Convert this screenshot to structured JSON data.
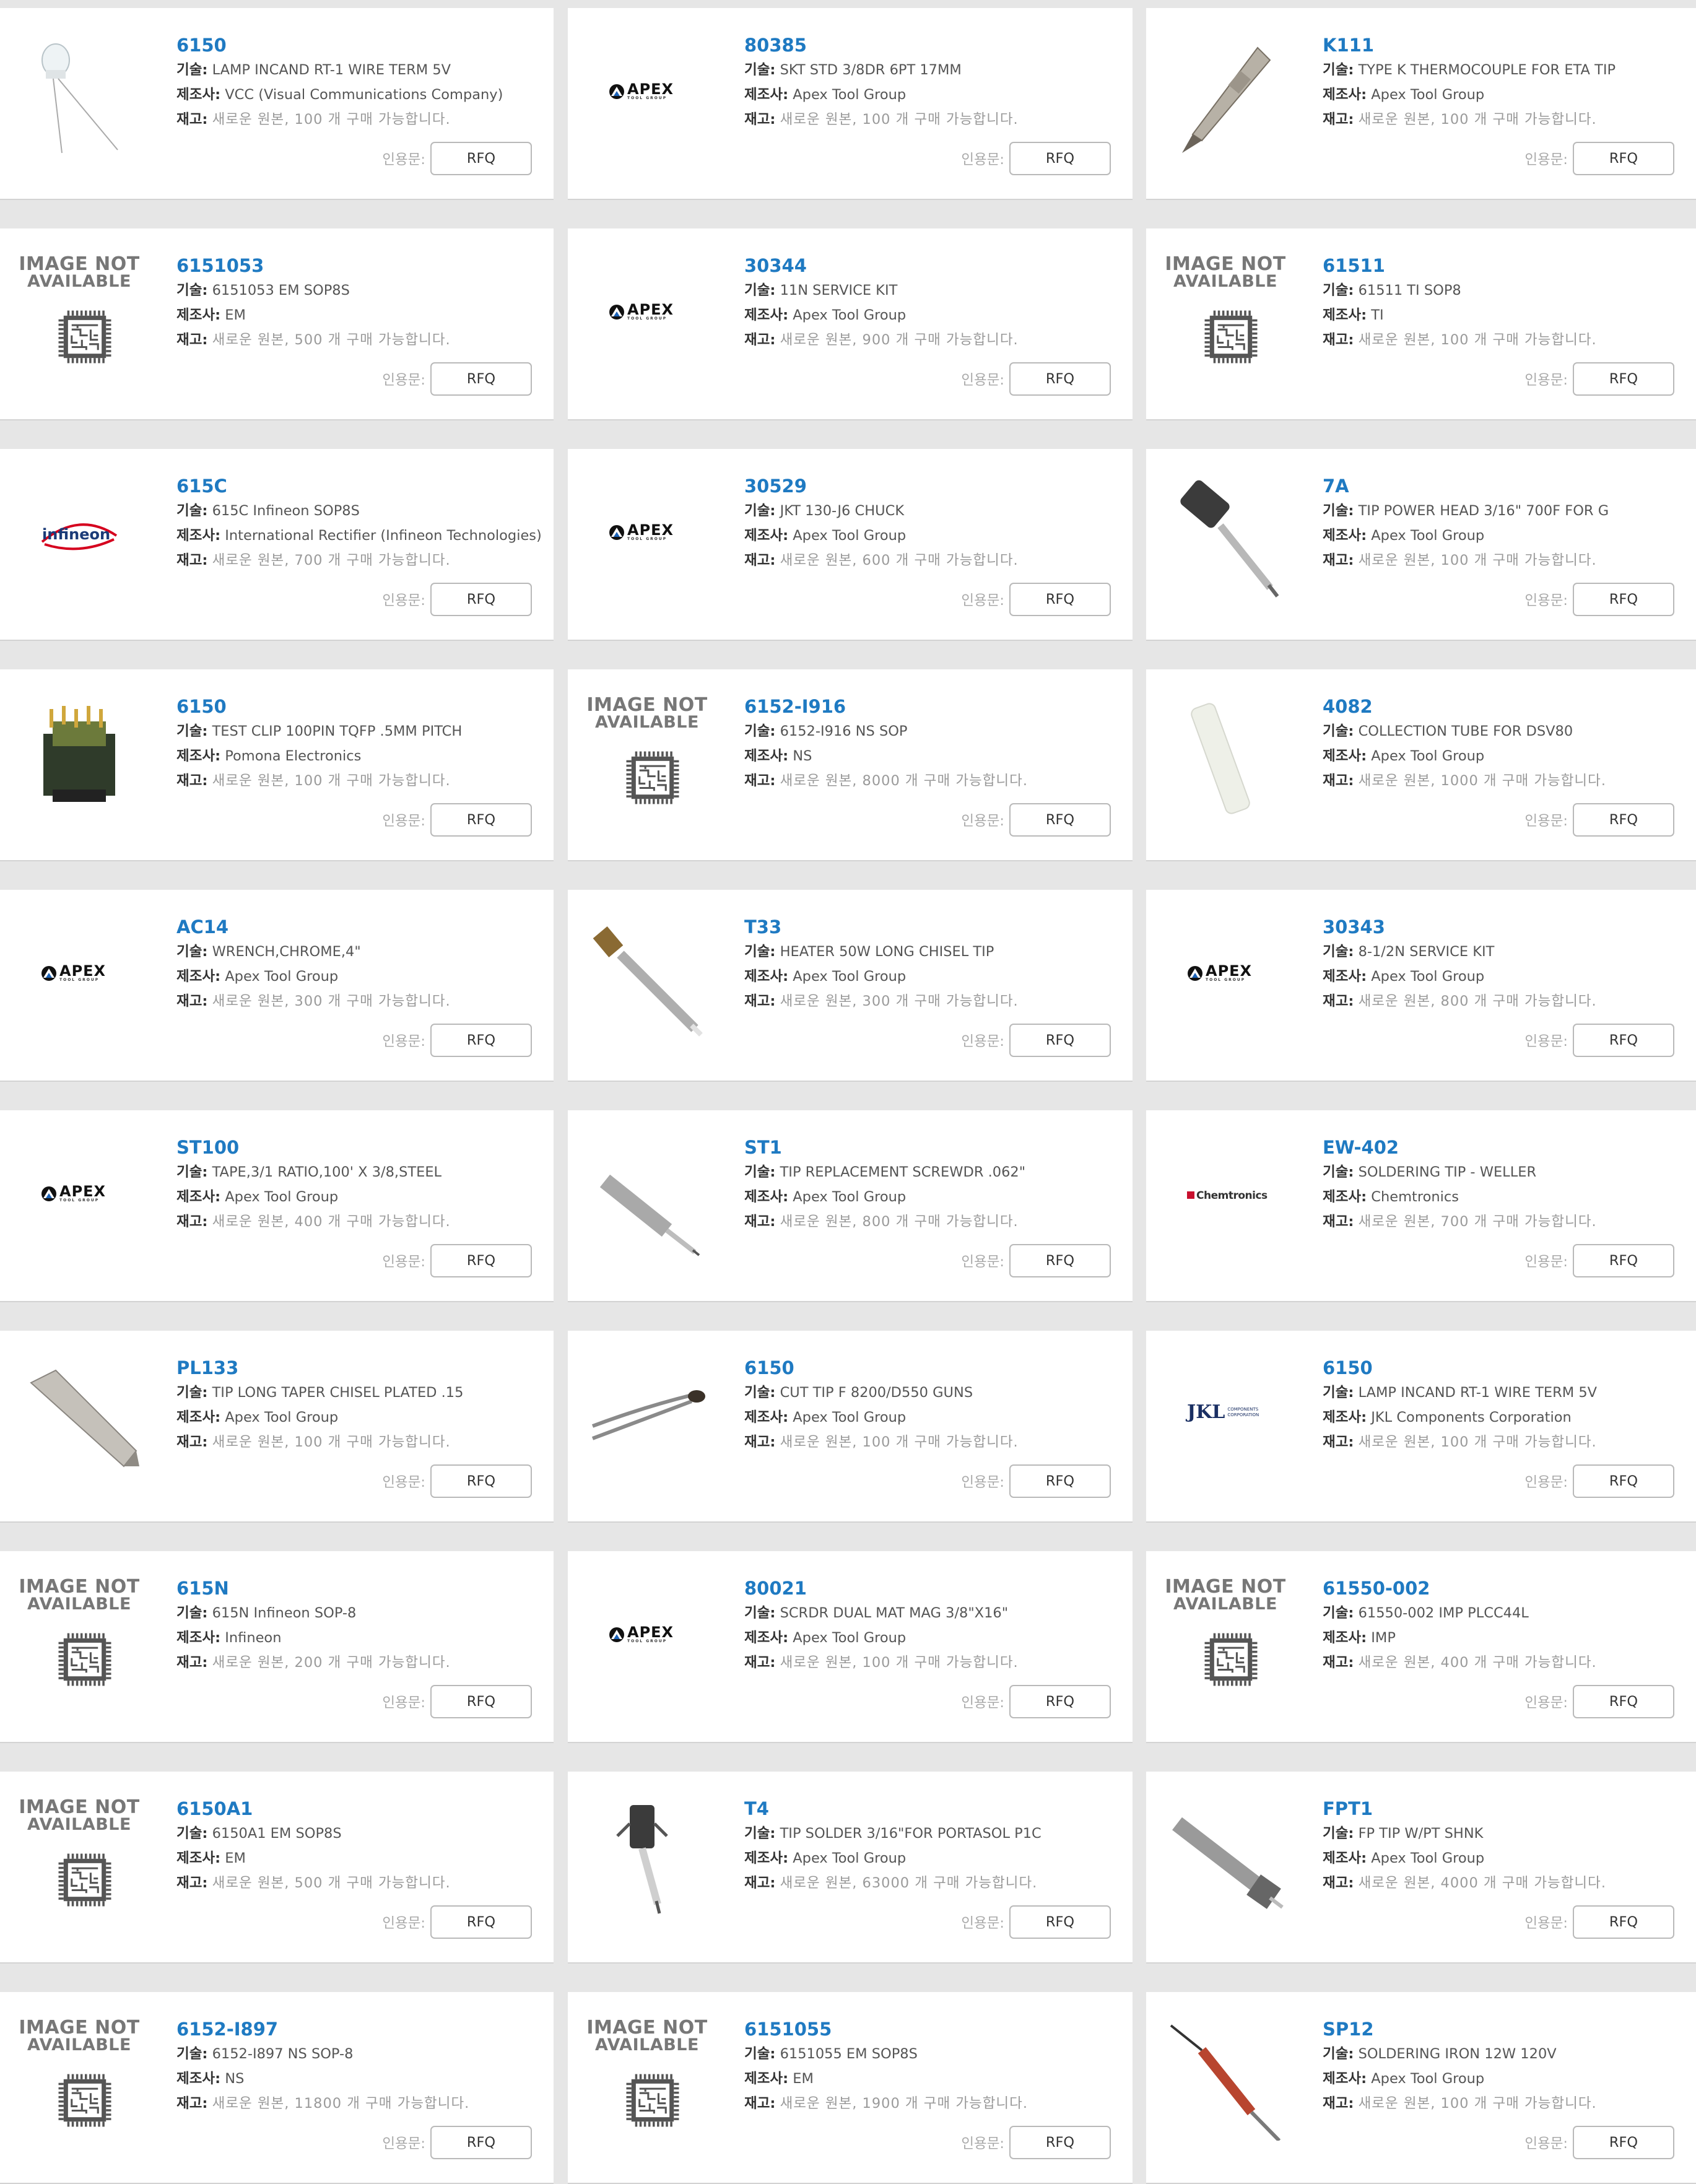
{
  "labels": {
    "description": "기술:",
    "manufacturer": "제조사:",
    "stock": "재고:",
    "quote": "인용문:",
    "rfq": "RFQ",
    "image_not_available_1": "IMAGE NOT",
    "image_not_available_2": "AVAILABLE",
    "apex_logo": "APEX",
    "apex_sub": "TOOL GROUP",
    "infineon_logo": "infineon",
    "chemtronics_logo": "Chemtronics",
    "jkl_logo": "JKL",
    "jkl_sub": "COMPONENTS CORPORATION"
  },
  "products": [
    {
      "part": "6150",
      "desc": "LAMP INCAND RT-1 WIRE TERM 5V",
      "mfr": "VCC (Visual Communications Company)",
      "stock": "새로운 원본, 100 개 구매 가능합니다.",
      "image": "lamp-photo"
    },
    {
      "part": "80385",
      "desc": "SKT STD 3/8DR 6PT 17MM",
      "mfr": "Apex Tool Group",
      "stock": "새로운 원본, 100 개 구매 가능합니다.",
      "image": "apex-logo"
    },
    {
      "part": "K111",
      "desc": "TYPE K THERMOCOUPLE FOR ETA TIP",
      "mfr": "Apex Tool Group",
      "stock": "새로운 원본, 100 개 구매 가능합니다.",
      "image": "tip-photo"
    },
    {
      "part": "6151053",
      "desc": "6151053 EM SOP8S",
      "mfr": "EM",
      "stock": "새로운 원본, 500 개 구매 가능합니다.",
      "image": "image-not-available"
    },
    {
      "part": "30344",
      "desc": "11N SERVICE KIT",
      "mfr": "Apex Tool Group",
      "stock": "새로운 원본, 900 개 구매 가능합니다.",
      "image": "apex-logo"
    },
    {
      "part": "61511",
      "desc": "61511 TI SOP8",
      "mfr": "TI",
      "stock": "새로운 원본, 100 개 구매 가능합니다.",
      "image": "image-not-available"
    },
    {
      "part": "615C",
      "desc": "615C Infineon SOP8S",
      "mfr": "International Rectifier (Infineon Technologies)",
      "stock": "새로운 원본, 700 개 구매 가능합니다.",
      "image": "infineon-logo"
    },
    {
      "part": "30529",
      "desc": "JKT 130-J6 CHUCK",
      "mfr": "Apex Tool Group",
      "stock": "새로운 원본, 600 개 구매 가능합니다.",
      "image": "apex-logo"
    },
    {
      "part": "7A",
      "desc": "TIP POWER HEAD 3/16\" 700F FOR G",
      "mfr": "Apex Tool Group",
      "stock": "새로운 원본, 100 개 구매 가능합니다.",
      "image": "power-head-photo"
    },
    {
      "part": "6150",
      "desc": "TEST CLIP 100PIN TQFP .5MM PITCH",
      "mfr": "Pomona Electronics",
      "stock": "새로운 원본, 100 개 구매 가능합니다.",
      "image": "test-clip-photo"
    },
    {
      "part": "6152-I916",
      "desc": "6152-I916 NS SOP",
      "mfr": "NS",
      "stock": "새로운 원본, 8000 개 구매 가능합니다.",
      "image": "image-not-available"
    },
    {
      "part": "4082",
      "desc": "COLLECTION TUBE FOR DSV80",
      "mfr": "Apex Tool Group",
      "stock": "새로운 원본, 1000 개 구매 가능합니다.",
      "image": "tube-photo"
    },
    {
      "part": "AC14",
      "desc": "WRENCH,CHROME,4\"",
      "mfr": "Apex Tool Group",
      "stock": "새로운 원본, 300 개 구매 가능합니다.",
      "image": "apex-logo"
    },
    {
      "part": "T33",
      "desc": "HEATER 50W LONG CHISEL TIP",
      "mfr": "Apex Tool Group",
      "stock": "새로운 원본, 300 개 구매 가능합니다.",
      "image": "heater-photo"
    },
    {
      "part": "30343",
      "desc": "8-1/2N SERVICE KIT",
      "mfr": "Apex Tool Group",
      "stock": "새로운 원본, 800 개 구매 가능합니다.",
      "image": "apex-logo"
    },
    {
      "part": "ST100",
      "desc": "TAPE,3/1 RATIO,100' X 3/8,STEEL",
      "mfr": "Apex Tool Group",
      "stock": "새로운 원본, 400 개 구매 가능합니다.",
      "image": "apex-logo"
    },
    {
      "part": "ST1",
      "desc": "TIP REPLACEMENT SCREWDR .062\"",
      "mfr": "Apex Tool Group",
      "stock": "새로운 원본, 800 개 구매 가능합니다.",
      "image": "screwdriver-tip-photo"
    },
    {
      "part": "EW-402",
      "desc": "SOLDERING TIP - WELLER",
      "mfr": "Chemtronics",
      "stock": "새로운 원본, 700 개 구매 가능합니다.",
      "image": "chemtronics-logo"
    },
    {
      "part": "PL133",
      "desc": "TIP LONG TAPER CHISEL PLATED .15",
      "mfr": "Apex Tool Group",
      "stock": "새로운 원본, 100 개 구매 가능합니다.",
      "image": "chisel-photo"
    },
    {
      "part": "6150",
      "desc": "CUT TIP F 8200/D550 GUNS",
      "mfr": "Apex Tool Group",
      "stock": "새로운 원본, 100 개 구매 가능합니다.",
      "image": "cut-tip-photo"
    },
    {
      "part": "6150",
      "desc": "LAMP INCAND RT-1 WIRE TERM 5V",
      "mfr": "JKL Components Corporation",
      "stock": "새로운 원본, 100 개 구매 가능합니다.",
      "image": "jkl-logo"
    },
    {
      "part": "615N",
      "desc": "615N Infineon SOP-8",
      "mfr": "Infineon",
      "stock": "새로운 원본, 200 개 구매 가능합니다.",
      "image": "image-not-available"
    },
    {
      "part": "80021",
      "desc": "SCRDR DUAL MAT MAG 3/8\"X16\"",
      "mfr": "Apex Tool Group",
      "stock": "새로운 원본, 100 개 구매 가능합니다.",
      "image": "apex-logo"
    },
    {
      "part": "61550-002",
      "desc": "61550-002 IMP PLCC44L",
      "mfr": "IMP",
      "stock": "새로운 원본, 400 개 구매 가능합니다.",
      "image": "image-not-available"
    },
    {
      "part": "6150A1",
      "desc": "6150A1 EM SOP8S",
      "mfr": "EM",
      "stock": "새로운 원본, 500 개 구매 가능합니다.",
      "image": "image-not-available"
    },
    {
      "part": "T4",
      "desc": "TIP SOLDER 3/16\"FOR PORTASOL P1C",
      "mfr": "Apex Tool Group",
      "stock": "새로운 원본, 63000 개 구매 가능합니다.",
      "image": "portasol-tip-photo"
    },
    {
      "part": "FPT1",
      "desc": "FP TIP W/PT SHNK",
      "mfr": "Apex Tool Group",
      "stock": "새로운 원본, 4000 개 구매 가능합니다.",
      "image": "fp-tip-photo"
    },
    {
      "part": "6152-I897",
      "desc": "6152-I897 NS SOP-8",
      "mfr": "NS",
      "stock": "새로운 원본, 11800 개 구매 가능합니다.",
      "image": "image-not-available"
    },
    {
      "part": "6151055",
      "desc": "6151055 EM SOP8S",
      "mfr": "EM",
      "stock": "새로운 원본, 1900 개 구매 가능합니다.",
      "image": "image-not-available"
    },
    {
      "part": "SP12",
      "desc": "SOLDERING IRON 12W 120V",
      "mfr": "Apex Tool Group",
      "stock": "새로운 원본, 100 개 구매 가능합니다.",
      "image": "soldering-iron-photo"
    }
  ]
}
